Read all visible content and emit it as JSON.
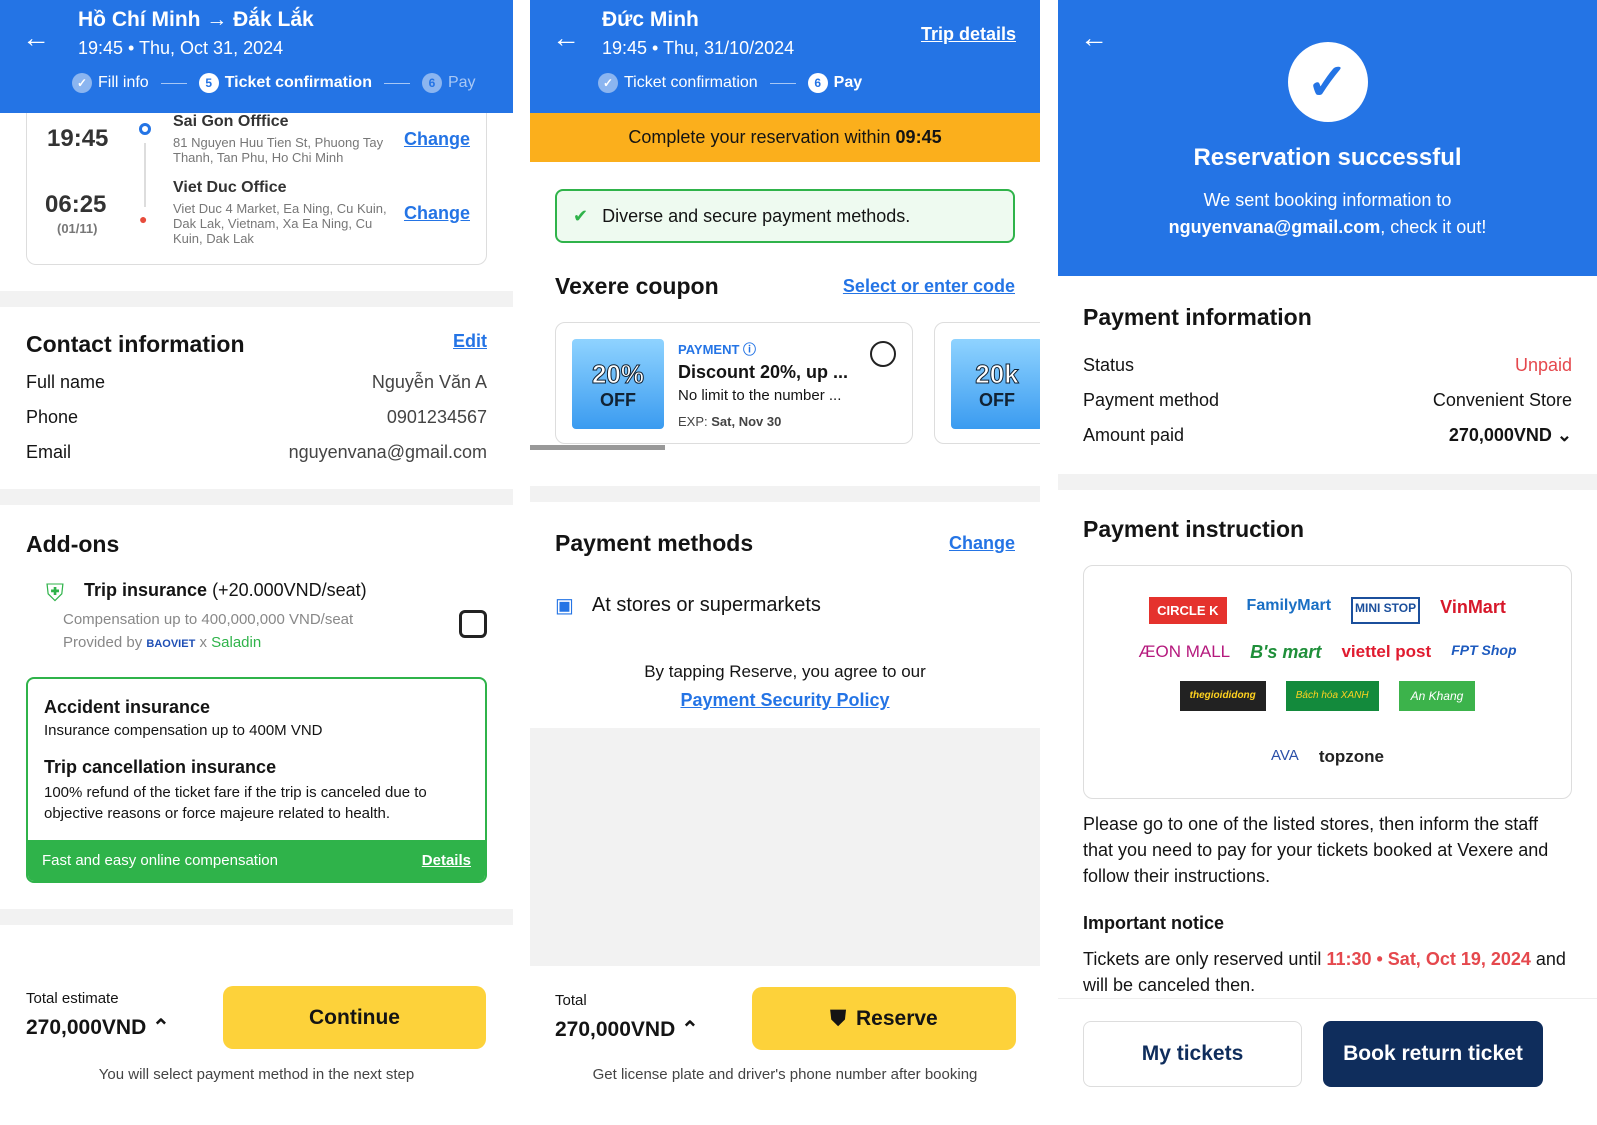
{
  "p1": {
    "title": "Hồ Chí Minh → Đắk Lắk",
    "subtitle": "19:45 • Thu, Oct 31, 2024",
    "steps": [
      "Fill info",
      "Ticket confirmation",
      "Pay"
    ],
    "step_nums": [
      "✓",
      "5",
      "6"
    ],
    "pickup": {
      "time": "19:45",
      "name": "Sai Gon Offfice",
      "addr": "81 Nguyen Huu Tien St, Phuong Tay Thanh, Tan Phu, Ho Chi Minh",
      "change": "Change"
    },
    "dropoff": {
      "time": "06:25",
      "date": "(01/11)",
      "name": "Viet Duc Office",
      "addr": "Viet Duc 4 Market, Ea Ning, Cu Kuin, Dak Lak, Vietnam, Xa Ea Ning, Cu Kuin, Dak Lak",
      "change": "Change"
    },
    "contact": {
      "title": "Contact information",
      "edit": "Edit",
      "rows": [
        [
          "Full name",
          "Nguyễn Văn A"
        ],
        [
          "Phone",
          "0901234567"
        ],
        [
          "Email",
          "nguyenvana@gmail.com"
        ]
      ]
    },
    "addons": {
      "title": "Add-ons",
      "ins_name": "Trip insurance",
      "ins_price": "(+20.000VND/seat)",
      "comp": "Compensation up to 400,000,000 VND/seat",
      "provided": "Provided by",
      "p1": "BAOVIET",
      "x": "x",
      "p2": "Saladin",
      "acc_t": "Accident insurance",
      "acc_d": "Insurance compensation up to 400M VND",
      "can_t": "Trip cancellation insurance",
      "can_d": "100% refund of the ticket fare if the trip is canceled due to objective reasons or force majeure related to health.",
      "foot": "Fast and easy online compensation",
      "details": "Details"
    },
    "total_label": "Total estimate",
    "total": "270,000VND",
    "continue": "Continue",
    "note": "You will select payment method in the next step"
  },
  "p2": {
    "title": "Đức Minh",
    "subtitle": "19:45 • Thu, 31/10/2024",
    "trip_details": "Trip details",
    "steps": [
      "Ticket confirmation",
      "Pay"
    ],
    "step_nums": [
      "✓",
      "6"
    ],
    "timer_text": "Complete your reservation within",
    "timer": "09:45",
    "secure": "Diverse and secure payment methods.",
    "coupon_title": "Vexere coupon",
    "coupon_link": "Select or enter code",
    "coupons": [
      {
        "img1": "20%",
        "img2": "OFF",
        "tag": "PAYMENT",
        "title": "Discount 20%, up ...",
        "desc": "No limit to the number ...",
        "exp_l": "EXP:",
        "exp": "Sat, Nov 30"
      },
      {
        "img1": "20k",
        "img2": "OFF"
      }
    ],
    "pm_title": "Payment methods",
    "pm_change": "Change",
    "pm_method": "At stores or supermarkets",
    "agree": "By tapping Reserve, you agree to our",
    "policy": "Payment Security Policy",
    "total_label": "Total",
    "total": "270,000VND",
    "reserve": "Reserve",
    "note": "Get license plate and driver's phone number after booking"
  },
  "p3": {
    "title": "Reservation successful",
    "sent": "We sent booking information to",
    "email": "nguyenvana@gmail.com",
    "check": ", check it out!",
    "pi_title": "Payment information",
    "rows": [
      [
        "Status",
        "Unpaid"
      ],
      [
        "Payment method",
        "Convenient Store"
      ],
      [
        "Amount paid",
        "270,000VND"
      ]
    ],
    "instr_title": "Payment instruction",
    "stores": [
      "CIRCLE K",
      "FamilyMart",
      "MINI STOP",
      "VinMart",
      "ÆON MALL",
      "B's mart",
      "viettel post",
      "FPT Shop",
      "thegioididong",
      "Bách hóa XANH",
      "An Khang",
      "AVA",
      "topzone"
    ],
    "instr": "Please go to one of the listed stores, then inform the staff that you need to pay for your tickets booked at Vexere and follow their instructions.",
    "notice_title": "Important notice",
    "notice_pre": "Tickets are only reserved until",
    "notice_time": "11:30 • Sat, Oct 19, 2024",
    "notice_post": "and will be canceled then.",
    "my_tickets": "My tickets",
    "book_return": "Book return ticket"
  }
}
